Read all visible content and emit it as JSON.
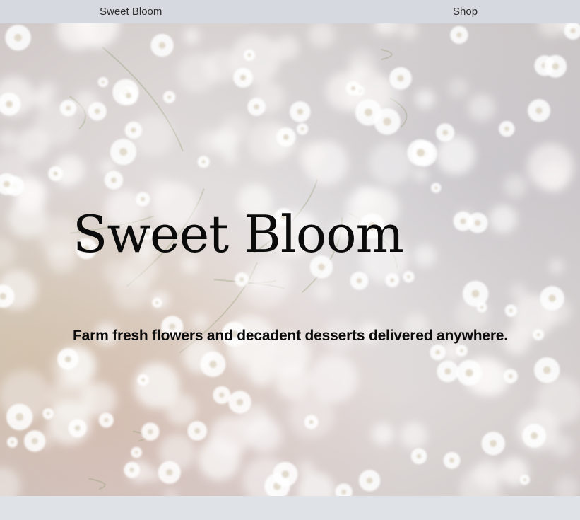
{
  "nav": {
    "brand_label": "Sweet Bloom",
    "shop_label": "Shop"
  },
  "hero": {
    "title": "Sweet Bloom",
    "subtitle": "Farm fresh flowers and decadent desserts delivered anywhere.",
    "background_image": "blurred-babys-breath-flowers"
  },
  "colors": {
    "navbar_bg": "#d6dae0",
    "text": "#0b0b0b",
    "footer_bg": "#dfe2e6"
  }
}
